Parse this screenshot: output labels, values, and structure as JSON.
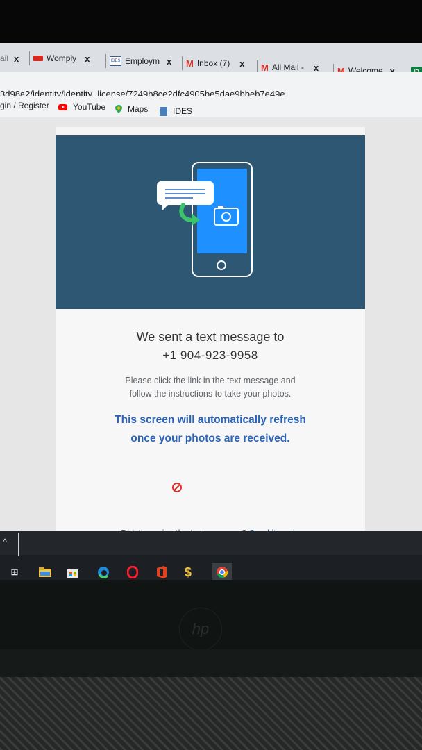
{
  "browser": {
    "tabs": [
      {
        "label": "ail",
        "close": "x",
        "favicon": "none"
      },
      {
        "label": "Womply",
        "close": "x",
        "favicon": "womply-icon"
      },
      {
        "label": "Employm",
        "close": "x",
        "favicon": "ides-icon"
      },
      {
        "label": "Inbox (7)",
        "close": "x",
        "favicon": "gmail-icon"
      },
      {
        "label": "All Mail -",
        "close": "x",
        "favicon": "gmail-icon"
      },
      {
        "label": "Welcome",
        "close": "x",
        "favicon": "gmail-icon"
      },
      {
        "label": "ID",
        "favicon": "id-icon"
      }
    ],
    "url": "3d98a2/identity/identity_license/7249b8ce2dfc4905be5dae9bbeb7e49e",
    "bookmarks": [
      {
        "label": "gin / Register",
        "icon": "none"
      },
      {
        "label": "YouTube",
        "icon": "youtube-icon"
      },
      {
        "label": "Maps",
        "icon": "maps-icon"
      },
      {
        "label": "IDES",
        "icon": "ides-icon"
      }
    ]
  },
  "page": {
    "title": "We sent a text message to",
    "phone": "+1 904-923-9958",
    "instruction_line1": "Please click the link in the text message and",
    "instruction_line2": "follow the instructions to take your photos.",
    "refresh_line1": "This screen will automatically refresh",
    "refresh_line2": "once your photos are received.",
    "resend_prompt": "Didn't receive the text message?",
    "resend_link": "Send it again"
  },
  "colors": {
    "hero_background": "#2e5773",
    "phone_screen": "#1e90ff",
    "accent_link": "#2a63b8",
    "spinner_red": "#e0312a"
  },
  "taskbar": {
    "icons": [
      "task-view-icon",
      "file-explorer-icon",
      "store-icon",
      "edge-icon",
      "opera-icon",
      "office-icon",
      "dollar-app-icon",
      "chrome-icon"
    ]
  }
}
